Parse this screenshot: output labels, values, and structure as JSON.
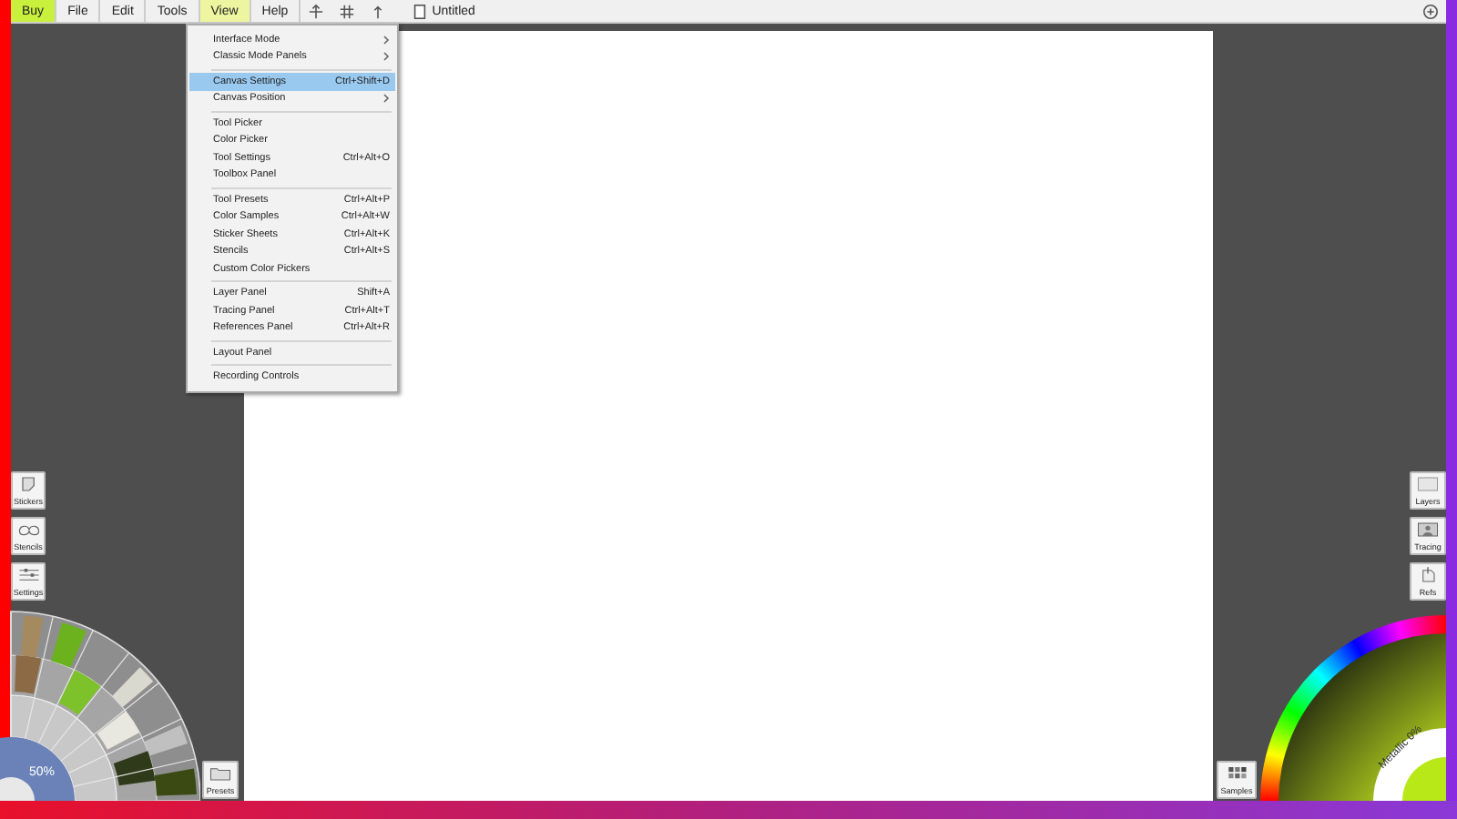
{
  "menubar": {
    "items": [
      {
        "label": "Buy",
        "kind": "promo",
        "selected": false
      },
      {
        "label": "File",
        "kind": "menu",
        "selected": false
      },
      {
        "label": "Edit",
        "kind": "menu",
        "selected": false
      },
      {
        "label": "Tools",
        "kind": "menu",
        "selected": false
      },
      {
        "label": "View",
        "kind": "menu",
        "selected": true
      },
      {
        "label": "Help",
        "kind": "menu",
        "selected": false
      }
    ],
    "document_title": "Untitled"
  },
  "view_menu": {
    "groups": [
      [
        {
          "label": "Interface Mode",
          "submenu": true,
          "selected": false
        },
        {
          "label": "Classic Mode Panels",
          "submenu": true,
          "selected": false
        }
      ],
      [
        {
          "label": "Canvas Settings",
          "shortcut": "Ctrl+Shift+D",
          "selected": true
        },
        {
          "label": "Canvas Position",
          "submenu": true,
          "selected": false
        }
      ],
      [
        {
          "label": "Tool Picker",
          "selected": false
        },
        {
          "label": "Color Picker",
          "selected": false
        },
        {
          "label": "Tool Settings",
          "shortcut": "Ctrl+Alt+O",
          "selected": false
        },
        {
          "label": "Toolbox Panel",
          "selected": false
        }
      ],
      [
        {
          "label": "Tool Presets",
          "shortcut": "Ctrl+Alt+P",
          "selected": false
        },
        {
          "label": "Color Samples",
          "shortcut": "Ctrl+Alt+W",
          "selected": false
        },
        {
          "label": "Sticker Sheets",
          "shortcut": "Ctrl+Alt+K",
          "selected": false
        },
        {
          "label": "Stencils",
          "shortcut": "Ctrl+Alt+S",
          "selected": false
        },
        {
          "label": "Custom Color Pickers",
          "selected": false
        }
      ],
      [
        {
          "label": "Layer Panel",
          "shortcut": "Shift+A",
          "selected": false
        },
        {
          "label": "Tracing Panel",
          "shortcut": "Ctrl+Alt+T",
          "selected": false
        },
        {
          "label": "References Panel",
          "shortcut": "Ctrl+Alt+R",
          "selected": false
        }
      ],
      [
        {
          "label": "Layout Panel",
          "selected": false
        }
      ],
      [
        {
          "label": "Recording Controls",
          "selected": false
        }
      ]
    ]
  },
  "left_panels": [
    {
      "label": "Stickers",
      "kind": "stickers"
    },
    {
      "label": "Stencils",
      "kind": "stencils"
    },
    {
      "label": "Settings",
      "kind": "settings"
    }
  ],
  "right_panels": [
    {
      "label": "Layers",
      "kind": "layers"
    },
    {
      "label": "Tracing",
      "kind": "tracing"
    },
    {
      "label": "Refs",
      "kind": "refs"
    }
  ],
  "tool_wheel": {
    "zoom": "50%"
  },
  "presets_button": "Presets",
  "samples_button": "Samples",
  "color_picker": {
    "metallic": "Metallic 0%"
  }
}
